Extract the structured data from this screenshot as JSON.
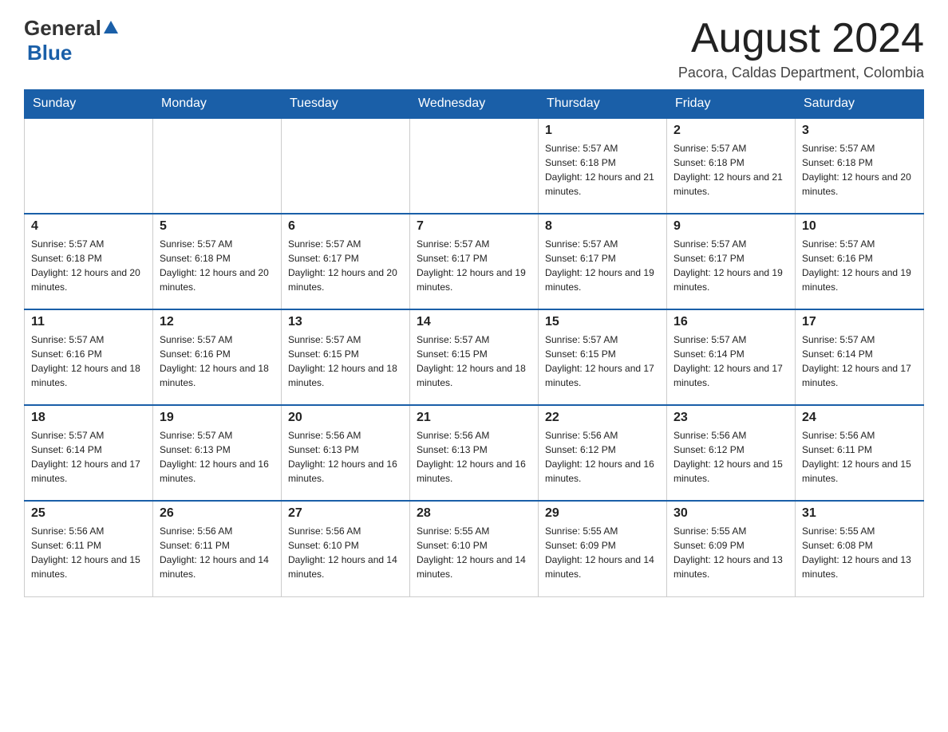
{
  "header": {
    "logo": {
      "general": "General",
      "blue": "Blue",
      "triangle": "▲"
    },
    "month_title": "August 2024",
    "location": "Pacora, Caldas Department, Colombia"
  },
  "weekdays": [
    "Sunday",
    "Monday",
    "Tuesday",
    "Wednesday",
    "Thursday",
    "Friday",
    "Saturday"
  ],
  "weeks": [
    [
      {
        "day": "",
        "info": ""
      },
      {
        "day": "",
        "info": ""
      },
      {
        "day": "",
        "info": ""
      },
      {
        "day": "",
        "info": ""
      },
      {
        "day": "1",
        "info": "Sunrise: 5:57 AM\nSunset: 6:18 PM\nDaylight: 12 hours and 21 minutes."
      },
      {
        "day": "2",
        "info": "Sunrise: 5:57 AM\nSunset: 6:18 PM\nDaylight: 12 hours and 21 minutes."
      },
      {
        "day": "3",
        "info": "Sunrise: 5:57 AM\nSunset: 6:18 PM\nDaylight: 12 hours and 20 minutes."
      }
    ],
    [
      {
        "day": "4",
        "info": "Sunrise: 5:57 AM\nSunset: 6:18 PM\nDaylight: 12 hours and 20 minutes."
      },
      {
        "day": "5",
        "info": "Sunrise: 5:57 AM\nSunset: 6:18 PM\nDaylight: 12 hours and 20 minutes."
      },
      {
        "day": "6",
        "info": "Sunrise: 5:57 AM\nSunset: 6:17 PM\nDaylight: 12 hours and 20 minutes."
      },
      {
        "day": "7",
        "info": "Sunrise: 5:57 AM\nSunset: 6:17 PM\nDaylight: 12 hours and 19 minutes."
      },
      {
        "day": "8",
        "info": "Sunrise: 5:57 AM\nSunset: 6:17 PM\nDaylight: 12 hours and 19 minutes."
      },
      {
        "day": "9",
        "info": "Sunrise: 5:57 AM\nSunset: 6:17 PM\nDaylight: 12 hours and 19 minutes."
      },
      {
        "day": "10",
        "info": "Sunrise: 5:57 AM\nSunset: 6:16 PM\nDaylight: 12 hours and 19 minutes."
      }
    ],
    [
      {
        "day": "11",
        "info": "Sunrise: 5:57 AM\nSunset: 6:16 PM\nDaylight: 12 hours and 18 minutes."
      },
      {
        "day": "12",
        "info": "Sunrise: 5:57 AM\nSunset: 6:16 PM\nDaylight: 12 hours and 18 minutes."
      },
      {
        "day": "13",
        "info": "Sunrise: 5:57 AM\nSunset: 6:15 PM\nDaylight: 12 hours and 18 minutes."
      },
      {
        "day": "14",
        "info": "Sunrise: 5:57 AM\nSunset: 6:15 PM\nDaylight: 12 hours and 18 minutes."
      },
      {
        "day": "15",
        "info": "Sunrise: 5:57 AM\nSunset: 6:15 PM\nDaylight: 12 hours and 17 minutes."
      },
      {
        "day": "16",
        "info": "Sunrise: 5:57 AM\nSunset: 6:14 PM\nDaylight: 12 hours and 17 minutes."
      },
      {
        "day": "17",
        "info": "Sunrise: 5:57 AM\nSunset: 6:14 PM\nDaylight: 12 hours and 17 minutes."
      }
    ],
    [
      {
        "day": "18",
        "info": "Sunrise: 5:57 AM\nSunset: 6:14 PM\nDaylight: 12 hours and 17 minutes."
      },
      {
        "day": "19",
        "info": "Sunrise: 5:57 AM\nSunset: 6:13 PM\nDaylight: 12 hours and 16 minutes."
      },
      {
        "day": "20",
        "info": "Sunrise: 5:56 AM\nSunset: 6:13 PM\nDaylight: 12 hours and 16 minutes."
      },
      {
        "day": "21",
        "info": "Sunrise: 5:56 AM\nSunset: 6:13 PM\nDaylight: 12 hours and 16 minutes."
      },
      {
        "day": "22",
        "info": "Sunrise: 5:56 AM\nSunset: 6:12 PM\nDaylight: 12 hours and 16 minutes."
      },
      {
        "day": "23",
        "info": "Sunrise: 5:56 AM\nSunset: 6:12 PM\nDaylight: 12 hours and 15 minutes."
      },
      {
        "day": "24",
        "info": "Sunrise: 5:56 AM\nSunset: 6:11 PM\nDaylight: 12 hours and 15 minutes."
      }
    ],
    [
      {
        "day": "25",
        "info": "Sunrise: 5:56 AM\nSunset: 6:11 PM\nDaylight: 12 hours and 15 minutes."
      },
      {
        "day": "26",
        "info": "Sunrise: 5:56 AM\nSunset: 6:11 PM\nDaylight: 12 hours and 14 minutes."
      },
      {
        "day": "27",
        "info": "Sunrise: 5:56 AM\nSunset: 6:10 PM\nDaylight: 12 hours and 14 minutes."
      },
      {
        "day": "28",
        "info": "Sunrise: 5:55 AM\nSunset: 6:10 PM\nDaylight: 12 hours and 14 minutes."
      },
      {
        "day": "29",
        "info": "Sunrise: 5:55 AM\nSunset: 6:09 PM\nDaylight: 12 hours and 14 minutes."
      },
      {
        "day": "30",
        "info": "Sunrise: 5:55 AM\nSunset: 6:09 PM\nDaylight: 12 hours and 13 minutes."
      },
      {
        "day": "31",
        "info": "Sunrise: 5:55 AM\nSunset: 6:08 PM\nDaylight: 12 hours and 13 minutes."
      }
    ]
  ]
}
